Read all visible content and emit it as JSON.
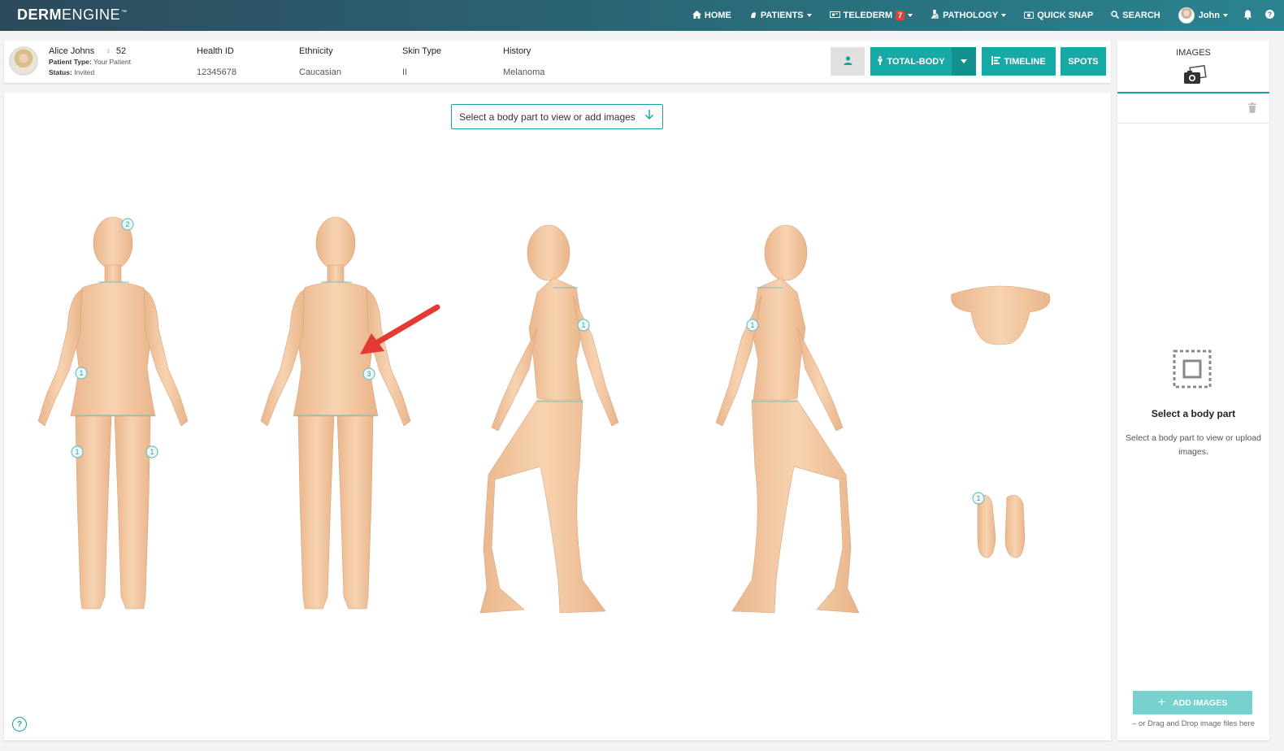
{
  "brand": {
    "bold": "DERM",
    "light": "ENGINE",
    "tm": "™"
  },
  "nav": {
    "home": "HOME",
    "patients": "PATIENTS",
    "telederm": "TELEDERM",
    "telederm_badge": "7",
    "pathology": "PATHOLOGY",
    "quick_snap": "QUICK SNAP",
    "search": "SEARCH",
    "user": "John"
  },
  "patient": {
    "name": "Alice Johns",
    "age": "52",
    "type_label": "Patient Type:",
    "type_value": "Your Patient",
    "status_label": "Status:",
    "status_value": "Invited",
    "health_id_label": "Health ID",
    "health_id": "12345678",
    "ethnicity_label": "Ethnicity",
    "ethnicity": "Caucasian",
    "skin_type_label": "Skin Type",
    "skin_type": "II",
    "history_label": "History",
    "history": "Melanoma"
  },
  "actions": {
    "total_body": "TOTAL-BODY",
    "timeline": "TIMELINE",
    "spots": "SPOTS"
  },
  "main": {
    "select_prompt": "Select a body part to view or add images",
    "help": "?",
    "markers": {
      "front_head": "2",
      "front_waist": "1",
      "front_left_thigh": "1",
      "front_right_thigh": "1",
      "back_lower": "3",
      "side_left_arm": "1",
      "side_right_arm": "1",
      "feet": "1"
    }
  },
  "right_panel": {
    "title": "IMAGES",
    "heading": "Select a body part",
    "description": "Select a body part to view or upload images.",
    "add_images": "ADD IMAGES",
    "drag_hint": "– or Drag and Drop image files here"
  },
  "colors": {
    "accent": "#17a9a5",
    "accent_light": "#77d1cf",
    "skin": "#f2c9a2",
    "arrow": "#e53935"
  }
}
